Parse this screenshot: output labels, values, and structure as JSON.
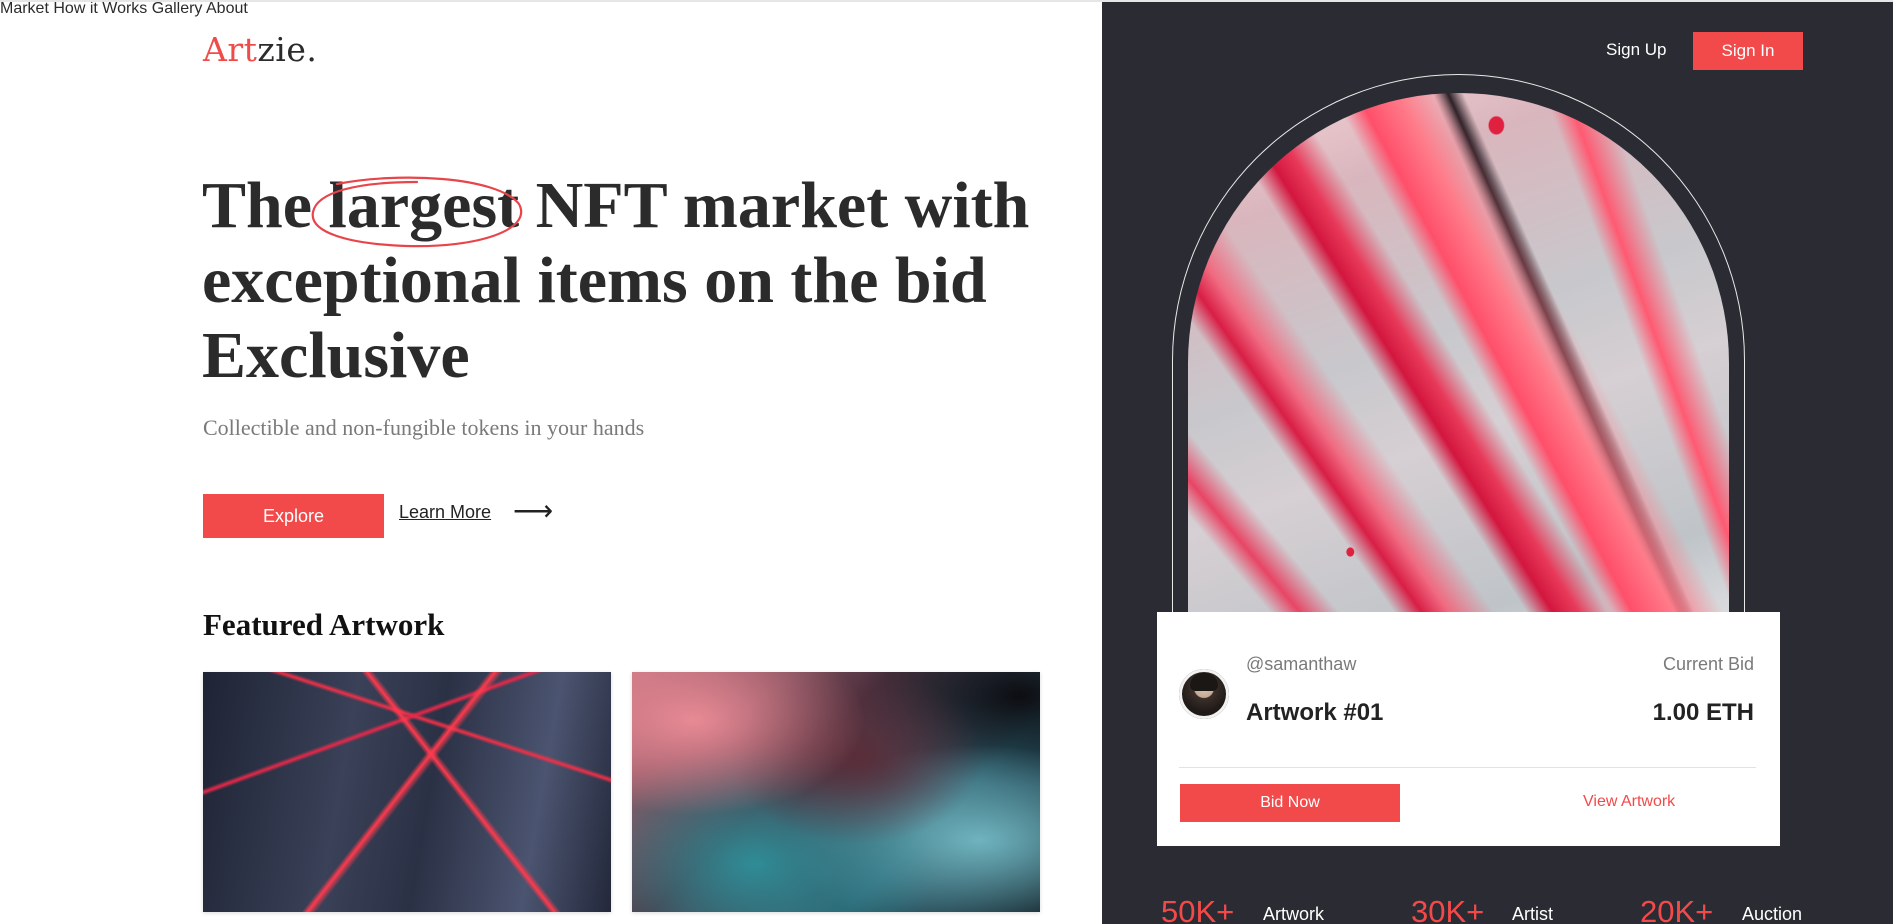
{
  "brand": {
    "logo_part1": "Art",
    "logo_part2": "zie",
    "logo_dot": ".",
    "accent_color": "#f24a4a",
    "dark_panel_color": "#2b2c33"
  },
  "nav": {
    "items": [
      "Market",
      "How it Works",
      "Gallery",
      "About"
    ]
  },
  "auth": {
    "sign_up": "Sign Up",
    "sign_in": "Sign In"
  },
  "hero": {
    "title_word1": "The",
    "title_highlight": "largest",
    "title_line1_rest": "NFT market with",
    "title_line2": "exceptional items on the bid",
    "title_line3": "Exclusive",
    "subtitle": "Collectible and non-fungible tokens in your hands",
    "explore_label": "Explore",
    "learn_more_label": "Learn More",
    "arrow_icon": "arrow-right-icon"
  },
  "featured": {
    "title": "Featured Artwork"
  },
  "bid_card": {
    "handle": "@samanthaw",
    "artwork_name": "Artwork #01",
    "current_bid_label": "Current Bid",
    "bid_amount": "1.00 ETH",
    "bid_now_label": "Bid Now",
    "view_artwork_label": "View Artwork"
  },
  "stats": [
    {
      "value": "50K+",
      "label": "Artwork"
    },
    {
      "value": "30K+",
      "label": "Artist"
    },
    {
      "value": "20K+",
      "label": "Auction"
    }
  ]
}
